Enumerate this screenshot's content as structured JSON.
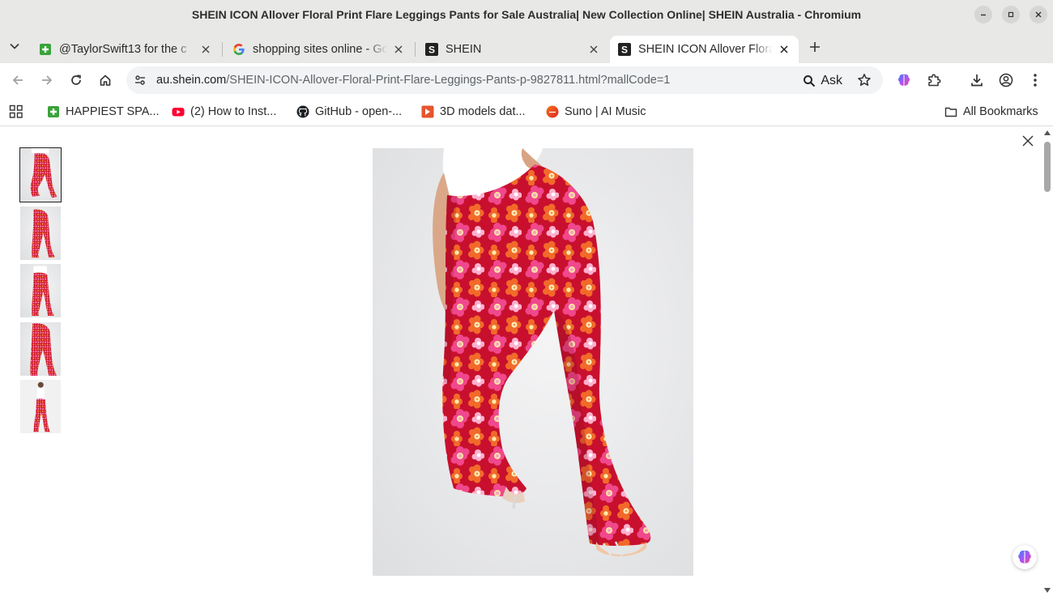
{
  "window": {
    "title": "SHEIN ICON Allover Floral Print Flare Leggings Pants for Sale Australia| New Collection Online| SHEIN Australia - Chromium"
  },
  "tabs": [
    {
      "label": "@TaylorSwift13 for the c",
      "favicon": "green-plus-favicon"
    },
    {
      "label": "shopping sites online - Go",
      "favicon": "google-favicon"
    },
    {
      "label": "SHEIN",
      "favicon": "shein-favicon"
    },
    {
      "label": "SHEIN ICON Allover Flora",
      "favicon": "shein-favicon",
      "active": true
    }
  ],
  "address_bar": {
    "host": "au.shein.com",
    "path": "/SHEIN-ICON-Allover-Floral-Print-Flare-Leggings-Pants-p-9827811.html?mallCode=1",
    "ask_label": "Ask"
  },
  "bookmarks": [
    {
      "label": "HAPPIEST SPA...",
      "favicon": "green-plus-favicon"
    },
    {
      "label": "(2) How to Inst...",
      "favicon": "youtube-favicon"
    },
    {
      "label": "GitHub - open-...",
      "favicon": "github-favicon"
    },
    {
      "label": "3D models dat...",
      "favicon": "3d-models-favicon"
    },
    {
      "label": "Suno | AI Music",
      "favicon": "suno-favicon"
    }
  ],
  "all_bookmarks_label": "All Bookmarks",
  "gallery": {
    "thumbnail_count": 5,
    "selected_index": 0
  },
  "colors": {
    "chrome_frame": "#e8e8e7",
    "omnibox": "#f1f3f4",
    "print_pink": "#f0488c",
    "print_orange": "#f26a2a",
    "print_red": "#c8102e"
  }
}
